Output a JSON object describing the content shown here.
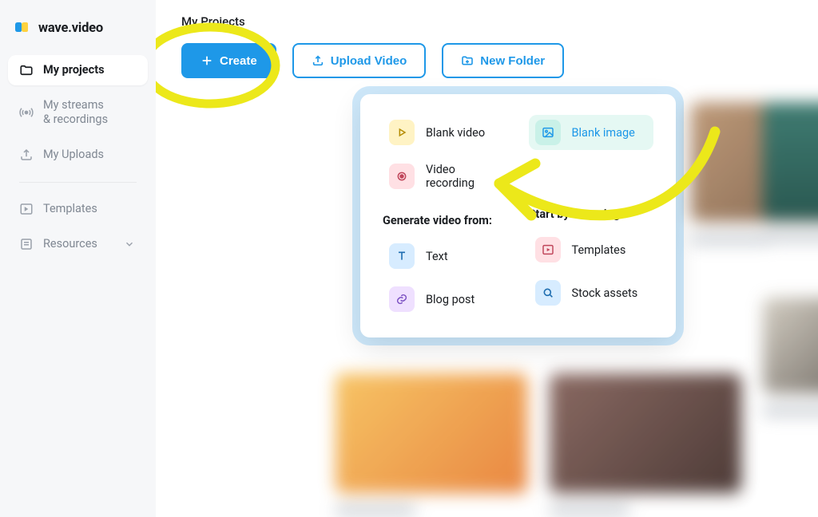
{
  "brand": {
    "name": "wave.video"
  },
  "sidebar": {
    "items": [
      {
        "label": "My projects"
      },
      {
        "label": "My streams\n& recordings"
      },
      {
        "label": "My Uploads"
      },
      {
        "label": "Templates"
      },
      {
        "label": "Resources"
      }
    ]
  },
  "page": {
    "title": "My Projects"
  },
  "toolbar": {
    "create": "Create",
    "upload": "Upload Video",
    "new_folder": "New Folder"
  },
  "dropdown": {
    "left": {
      "items": [
        {
          "label": "Blank video"
        },
        {
          "label": "Video recording"
        }
      ],
      "heading": "Generate video from:",
      "gen": [
        {
          "label": "Text"
        },
        {
          "label": "Blog post"
        }
      ]
    },
    "right": {
      "highlight": {
        "label": "Blank image"
      },
      "heading": "Start by browsing:",
      "browse": [
        {
          "label": "Templates"
        },
        {
          "label": "Stock assets"
        }
      ]
    }
  },
  "colors": {
    "accent": "#1e98e8",
    "highlight": "#ece81a"
  }
}
